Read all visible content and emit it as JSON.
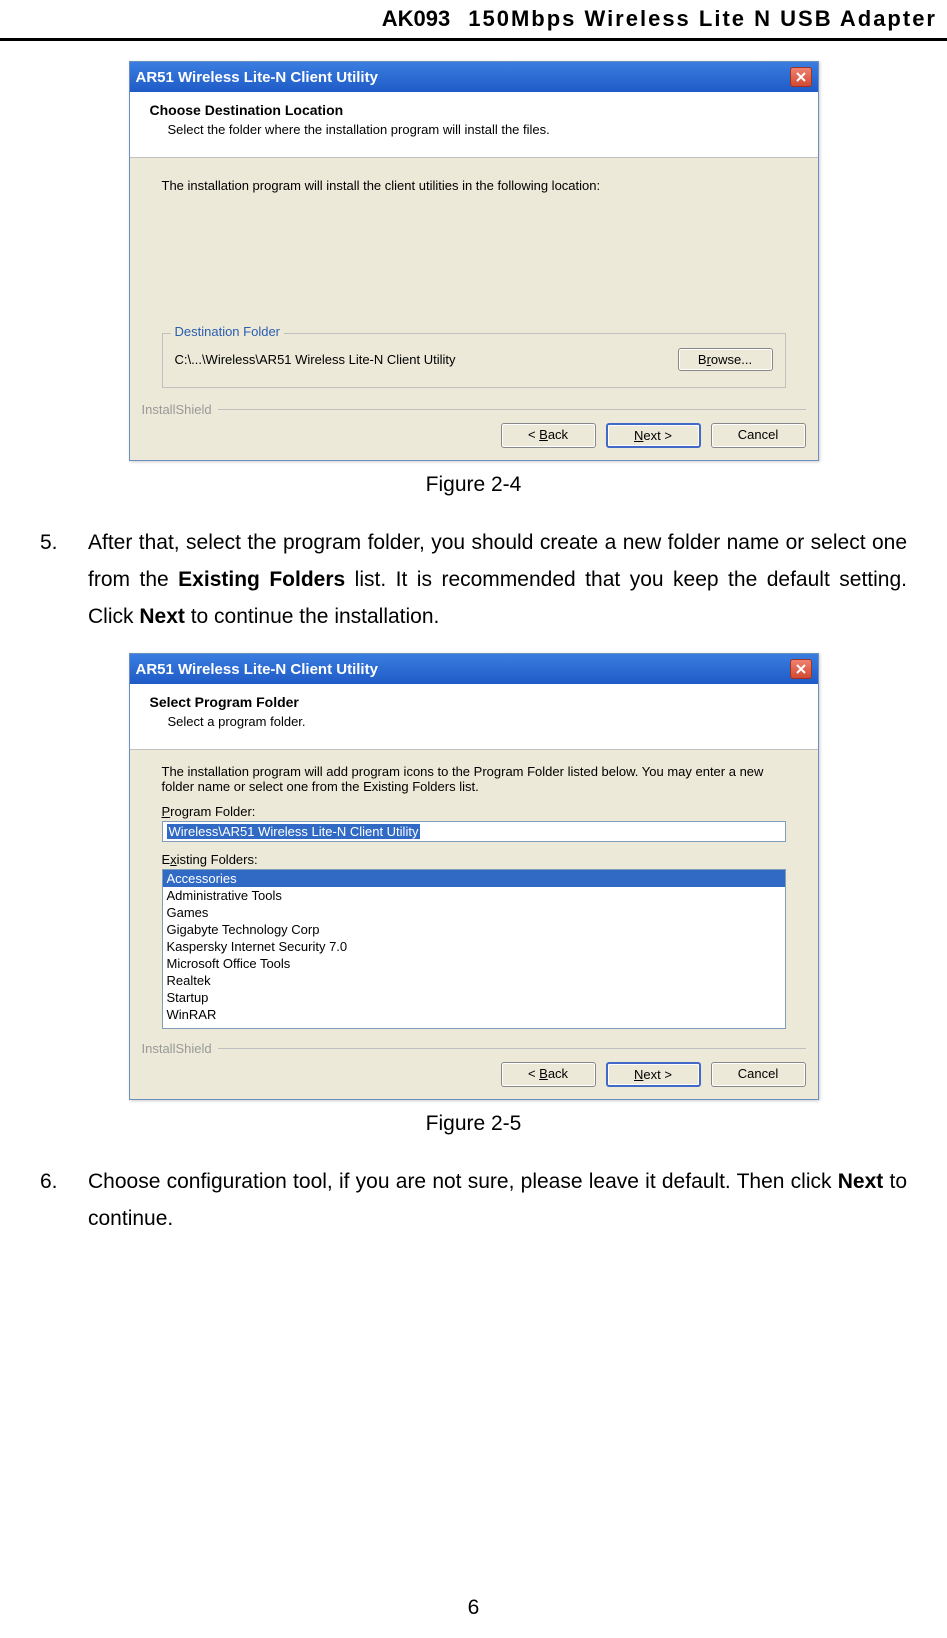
{
  "header": {
    "model": "AK093",
    "title": "150Mbps Wireless Lite N USB Adapter"
  },
  "dialog1": {
    "title": "AR51 Wireless Lite-N Client Utility",
    "close_aria": "Close",
    "heading": "Choose Destination Location",
    "subheading": "Select the folder where the installation program will install the files.",
    "message": "The installation program will install the client utilities in the following location:",
    "fieldset_label": "Destination Folder",
    "path": "C:\\...\\Wireless\\AR51 Wireless Lite-N Client Utility",
    "browse": "Browse...",
    "shield": "InstallShield",
    "back": "< Back",
    "next": "Next >",
    "cancel": "Cancel"
  },
  "caption1": "Figure 2-4",
  "step5": {
    "num": "5.",
    "p1a": "After that, select the program folder, you should create a new folder name or select one from the ",
    "p1b": "Existing Folders",
    "p1c": " list. It is recommended that you keep the default setting. Click ",
    "p1d": "Next",
    "p1e": " to continue the installation."
  },
  "dialog2": {
    "title": "AR51 Wireless Lite-N Client Utility",
    "close_aria": "Close",
    "heading": "Select Program Folder",
    "subheading": "Select a program folder.",
    "message": "The installation program will add program icons to the Program Folder listed below. You may enter a new folder name or select one from the Existing Folders list.",
    "pf_label": "Program Folder:",
    "pf_value": "Wireless\\AR51 Wireless Lite-N Client Utility",
    "ef_label": "Existing Folders:",
    "folders": [
      "Accessories",
      "Administrative Tools",
      "Games",
      "Gigabyte Technology Corp",
      "Kaspersky Internet Security 7.0",
      "Microsoft Office Tools",
      "Realtek",
      "Startup",
      "WinRAR"
    ],
    "shield": "InstallShield",
    "back": "< Back",
    "next": "Next >",
    "cancel": "Cancel"
  },
  "caption2": "Figure 2-5",
  "step6": {
    "num": "6.",
    "p1a": "Choose configuration tool, if you are not sure, please leave it default. Then click ",
    "p1b": "Next",
    "p1c": " to continue."
  },
  "pagenum": "6"
}
